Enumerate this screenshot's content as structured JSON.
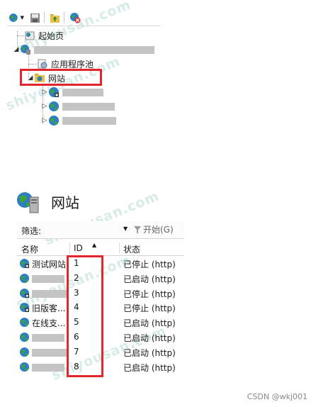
{
  "tree": {
    "start_page": "起始页",
    "app_pools": "应用程序池",
    "sites": "网站"
  },
  "panel": {
    "title": "网站",
    "filter_label": "筛选:",
    "start_button": "开始(G)"
  },
  "table": {
    "columns": [
      "名称",
      "ID",
      "状态"
    ],
    "rows": [
      {
        "name": "测试网站",
        "id": "1",
        "status": "已停止 (http)",
        "stopped": true
      },
      {
        "name": "",
        "id": "2",
        "status": "已启动 (http)",
        "stopped": false
      },
      {
        "name": "",
        "id": "3",
        "status": "已停止 (http)",
        "stopped": true
      },
      {
        "name": "旧版客...",
        "id": "4",
        "status": "已停止 (http)",
        "stopped": true
      },
      {
        "name": "在线支...",
        "id": "5",
        "status": "已启动 (http)",
        "stopped": false
      },
      {
        "name": "",
        "id": "6",
        "status": "已启动 (http)",
        "stopped": false
      },
      {
        "name": "",
        "id": "7",
        "status": "已启动 (http)",
        "stopped": false
      },
      {
        "name": "",
        "id": "8",
        "status": "已启动 (http)",
        "stopped": false
      }
    ]
  },
  "watermark": "shiyousan.com",
  "footer": "CSDN @wkj001",
  "colors": {
    "highlight": "#e3262b",
    "globe": "#2d7fc4",
    "land": "#3da43a"
  }
}
